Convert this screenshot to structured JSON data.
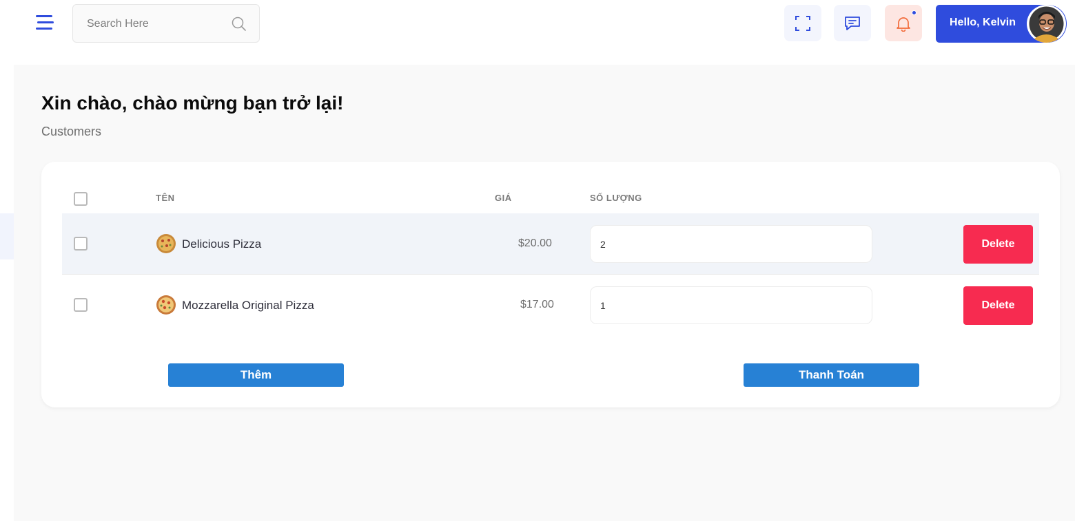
{
  "colors": {
    "accent": "#2f4cdd",
    "danger": "#f72b50",
    "action": "#2781d5",
    "bell_bg": "#fde6e2"
  },
  "header": {
    "menu_icon": "hamburger-icon",
    "search": {
      "placeholder": "Search Here",
      "icon": "search-icon"
    },
    "icons": [
      "fullscreen-icon",
      "chat-icon",
      "bell-icon"
    ],
    "greeting": "Hello, Kelvin"
  },
  "page": {
    "title": "Xin chào, chào mừng bạn trở lại!",
    "subtitle": "Customers"
  },
  "table": {
    "headers": {
      "name": "TÊN",
      "price": "GIÁ",
      "quantity": "SỐ LƯỢNG"
    },
    "rows": [
      {
        "name": "Delicious Pizza",
        "price": "$20.00",
        "quantity": "2",
        "delete_label": "Delete"
      },
      {
        "name": "Mozzarella Original Pizza",
        "price": "$17.00",
        "quantity": "1",
        "delete_label": "Delete"
      }
    ]
  },
  "actions": {
    "add_label": "Thêm",
    "checkout_label": "Thanh Toán"
  }
}
